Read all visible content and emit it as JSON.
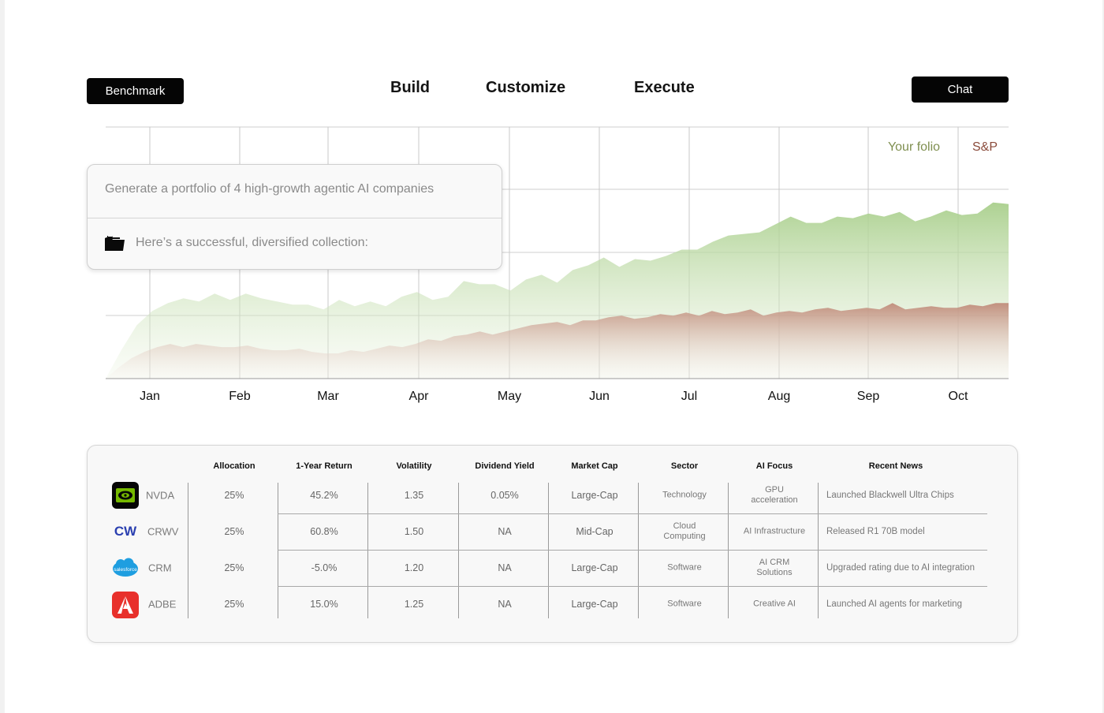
{
  "header": {
    "benchmark_label": "Benchmark",
    "nav": [
      "Build",
      "Customize",
      "Execute"
    ],
    "chat_label": "Chat"
  },
  "prompt": {
    "query": "Generate a portfolio of 4 high-growth agentic AI companies",
    "reply": "Here’s a successful, diversified collection:",
    "reply_icon": "folder-icon"
  },
  "chart_data": {
    "type": "area",
    "x": [
      "Jan",
      "Feb",
      "Mar",
      "Apr",
      "May",
      "Jun",
      "Jul",
      "Aug",
      "Sep",
      "Oct"
    ],
    "series": [
      {
        "name": "Your folio",
        "color": "#a9cf8c",
        "values": [
          0,
          1.8,
          3.4,
          4.3,
          4.8,
          5.1,
          4.9,
          5.4,
          5.0,
          5.4,
          5.1,
          4.9,
          4.7,
          4.7,
          4.4,
          5.0,
          4.6,
          4.9,
          4.6,
          5.2,
          5.5,
          5.0,
          5.2,
          6.2,
          6.0,
          6.0,
          5.6,
          6.3,
          6.6,
          6.1,
          6.9,
          7.2,
          7.7,
          7.1,
          7.6,
          7.5,
          7.8,
          8.2,
          8.2,
          8.7,
          9.1,
          9.2,
          9.3,
          9.8,
          10.3,
          9.9,
          9.9,
          10.3,
          10.2,
          10.5,
          10.3,
          10.6,
          10.0,
          10.3,
          10.7,
          10.4,
          10.5,
          11.2,
          11.1
        ],
        "color_label": "#7f8f50"
      },
      {
        "name": "S&P",
        "color": "#c79a8a",
        "values": [
          0,
          0.7,
          1.3,
          1.7,
          2.0,
          2.2,
          2.0,
          2.2,
          2.1,
          2.0,
          2.0,
          2.1,
          1.9,
          1.8,
          1.8,
          1.9,
          1.7,
          1.6,
          1.6,
          1.8,
          1.7,
          1.9,
          2.1,
          2.0,
          2.2,
          2.5,
          2.4,
          2.7,
          2.8,
          3.0,
          2.8,
          3.0,
          3.2,
          3.4,
          3.5,
          3.6,
          3.4,
          3.7,
          3.7,
          3.9,
          4.0,
          3.8,
          3.9,
          4.1,
          4.0,
          4.2,
          4.0,
          4.3,
          4.1,
          4.2,
          4.4,
          4.0,
          4.2,
          4.3,
          4.2,
          4.4,
          4.5,
          4.3,
          4.4,
          4.5,
          4.4,
          4.8,
          4.4,
          4.5,
          4.6,
          4.5,
          4.5,
          4.7,
          4.6,
          4.8,
          4.8
        ],
        "color_label": "#8a4a3a"
      }
    ],
    "grid": true,
    "legend": "top-right"
  },
  "table": {
    "columns": [
      "Allocation",
      "1-Year Return",
      "Volatility",
      "Dividend Yield",
      "Market Cap",
      "Sector",
      "AI Focus",
      "Recent News"
    ],
    "rows": [
      {
        "ticker": "NVDA",
        "logo": "nvidia-logo-icon",
        "cells": [
          "25%",
          "45.2%",
          "1.35",
          "0.05%",
          "Large-Cap",
          "Technology",
          "GPU\nacceleration",
          "Launched Blackwell Ultra Chips"
        ]
      },
      {
        "ticker": "CRWV",
        "logo": "coreweave-logo-icon",
        "cells": [
          "25%",
          "60.8%",
          "1.50",
          "NA",
          "Mid-Cap",
          "Cloud\nComputing",
          "AI Infrastructure",
          "Released R1 70B model"
        ]
      },
      {
        "ticker": "CRM",
        "logo": "salesforce-logo-icon",
        "cells": [
          "25%",
          "-5.0%",
          "1.20",
          "NA",
          "Large-Cap",
          "Software",
          "AI CRM\nSolutions",
          "Upgraded rating due to AI integration"
        ]
      },
      {
        "ticker": "ADBE",
        "logo": "adobe-logo-icon",
        "cells": [
          "25%",
          "15.0%",
          "1.25",
          "NA",
          "Large-Cap",
          "Software",
          "Creative AI",
          "Launched AI agents for marketing"
        ]
      }
    ]
  }
}
